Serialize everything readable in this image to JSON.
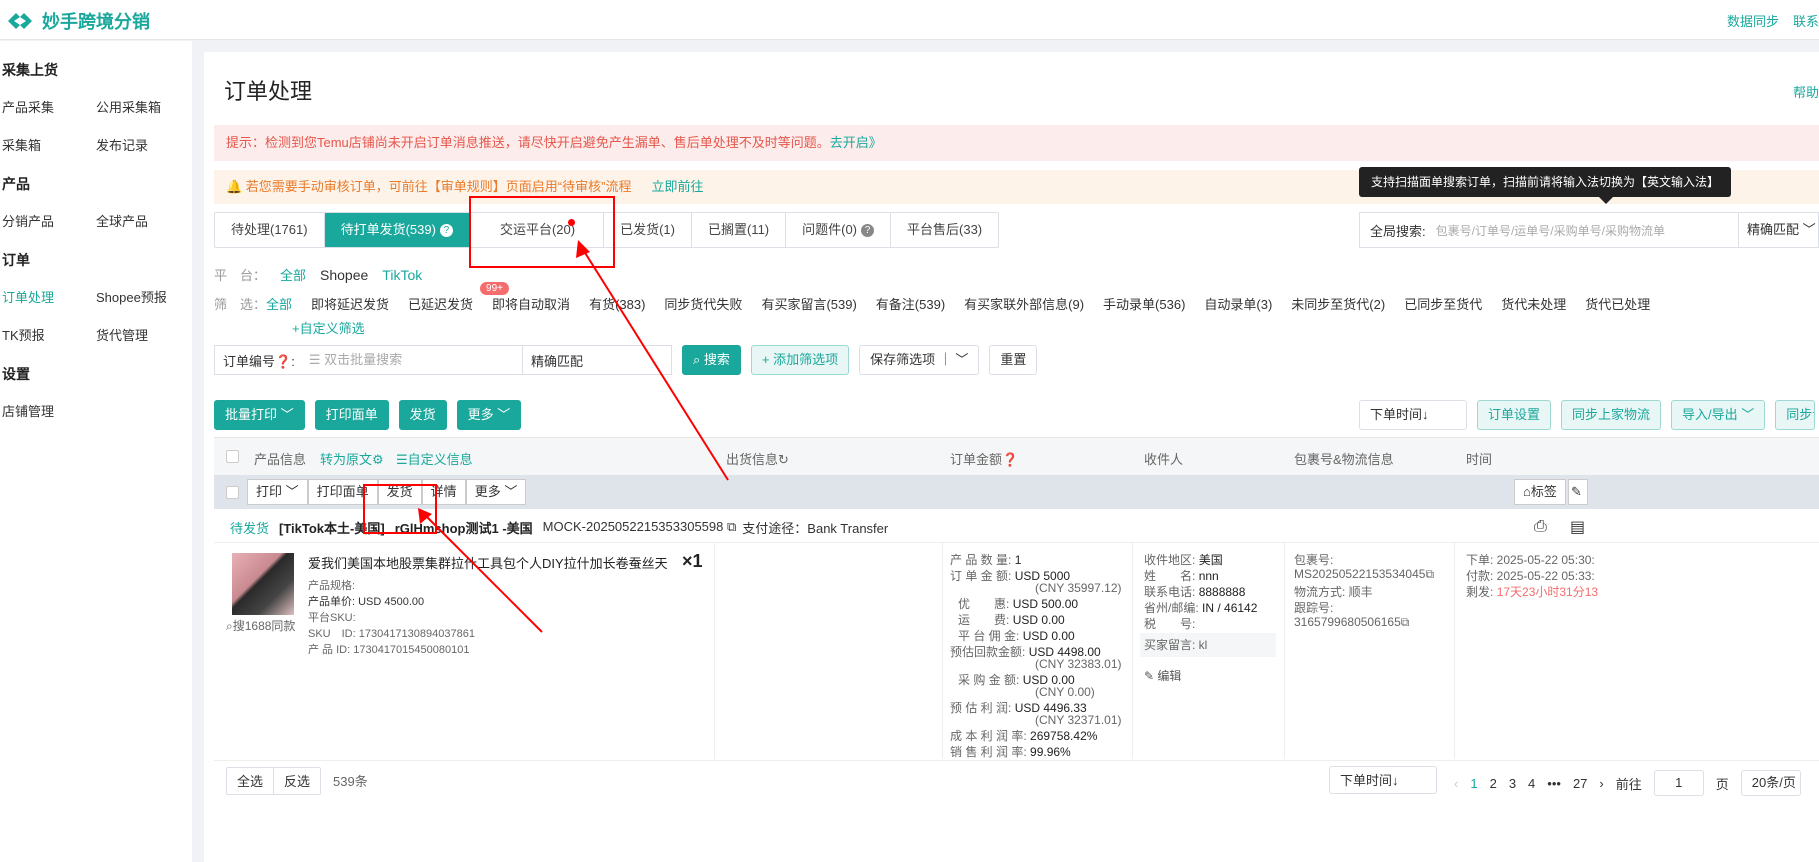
{
  "app": {
    "name": "妙手跨境分销",
    "top_links": [
      "数据同步",
      "联系"
    ]
  },
  "sidebar": [
    {
      "group": "采集上货",
      "rows": [
        [
          "产品采集",
          "公用采集箱"
        ],
        [
          "采集箱",
          "发布记录"
        ]
      ]
    },
    {
      "group": "产品",
      "rows": [
        [
          "分销产品",
          "全球产品"
        ]
      ]
    },
    {
      "group": "订单",
      "rows": [
        [
          "订单处理",
          "Shopee预报"
        ],
        [
          "TK预报",
          "货代管理"
        ]
      ]
    },
    {
      "group": "设置",
      "rows": [
        [
          "店铺管理"
        ]
      ]
    }
  ],
  "page": {
    "title": "订单处理",
    "help": "帮助"
  },
  "alerts": {
    "notice": "提示：检测到您Temu店铺尚未开启订单消息推送，请尽快开启避免产生漏单、售后单处理不及时等问题。",
    "notice_link": "去开启》",
    "review": "🔔 若您需要手动审核订单，可前往【审单规则】页面启用“待审核”流程",
    "review_link": "立即前往"
  },
  "tooltip": "支持扫描面单搜索订单，扫描前请将输入法切换为【英文输入法】",
  "tabs": [
    {
      "label": "待处理(1761)"
    },
    {
      "label": "待打单发货(539)",
      "active": true
    },
    {
      "label": "交运平台(20)"
    },
    {
      "label": "已发货(1)"
    },
    {
      "label": "已搁置(11)"
    },
    {
      "label": "问题件(0)"
    },
    {
      "label": "平台售后(33)"
    }
  ],
  "global_search": {
    "label": "全局搜索:",
    "placeholder": "包裹号/订单号/运单号/采购单号/采购物流单",
    "mode": "精确匹配"
  },
  "platform": {
    "label": "平　台：",
    "options": [
      "全部",
      "Shopee",
      "TikTok"
    ]
  },
  "filter": {
    "label": "筛　选：",
    "options": [
      "全部",
      "即将延迟发货",
      "已延迟发货",
      "即将自动取消",
      "有货(383)",
      "同步货代失败",
      "有买家留言(539)",
      "有备注(539)",
      "有买家联外部信息(9)",
      "手动录单(536)",
      "自动录单(3)",
      "未同步至货代(2)",
      "已同步至货代",
      "货代未处理",
      "货代已处理"
    ],
    "badge": "99+",
    "custom": "+自定义筛选"
  },
  "search_row": {
    "label": "订单编号",
    "placeholder": "双击批量搜索",
    "mode": "精确匹配",
    "search": "搜索",
    "add_filter": "+ 添加筛选项",
    "save_filter": "保存筛选项",
    "reset": "重置"
  },
  "actions": {
    "batch_print": "批量打印",
    "print_label": "打印面单",
    "ship": "发货",
    "more": "更多",
    "sort": "下单时间↓",
    "settings": "订单设置",
    "sync_logistics": "同步上家物流",
    "import_export": "导入/导出",
    "sync_order": "同步订单"
  },
  "table_head": {
    "product": "产品信息",
    "translate": "转为原文",
    "custom": "自定义信息",
    "shipping": "出货信息",
    "amount": "订单金额",
    "receiver": "收件人",
    "logistics": "包裹号&物流信息",
    "time": "时间"
  },
  "subbar": {
    "print": "打印",
    "print_label": "打印面单",
    "ship": "发货",
    "detail": "详情",
    "more": "更多",
    "tag": "标签",
    "note": "备注"
  },
  "order": {
    "status": "待发货",
    "shop": "[TikTok本土-美国]",
    "shop_name": "rGlHmshop测试1 -美国",
    "order_no": "MOCK-2025052215353305598",
    "payment": "支付途径：Bank Transfer",
    "product_title": "爱我们美国本地股票集群拉什工具包个人DIY拉什加长卷蚕丝天...",
    "spec": "产品规格:",
    "unit_price": "产品单价:  USD 4500.00",
    "platform_sku": "平台SKU:",
    "sku_id": "SKU　ID:  1730417130894037861",
    "product_id": "产 品 ID:  1730417015450080101",
    "same_1688": "搜1688同款",
    "qty": "×1",
    "amount": [
      [
        "产 品 数 量:",
        "1",
        ""
      ],
      [
        "订 单 金 额:",
        "USD 5000",
        "(CNY 35997.12)"
      ],
      [
        "优　　惠:",
        "USD 500.00",
        ""
      ],
      [
        "运　　费:",
        "USD 0.00",
        ""
      ],
      [
        "平 台 佣 金:",
        "USD 0.00",
        ""
      ],
      [
        "预估回款金额:",
        "USD 4498.00",
        "(CNY 32383.01)"
      ],
      [
        "采 购 金 额:",
        "USD 0.00",
        "(CNY 0.00)"
      ],
      [
        "预 估 利 润:",
        "USD 4496.33",
        "(CNY 32371.01)"
      ],
      [
        "成 本 利 润 率:",
        "269758.42%",
        ""
      ],
      [
        "销 售 利 润 率:",
        "99.96%",
        ""
      ]
    ],
    "receiver": [
      [
        "收件地区:",
        "美国"
      ],
      [
        "姓　　名:",
        "nnn"
      ],
      [
        "联系电话:",
        "8888888"
      ],
      [
        "省州/邮编:",
        "IN / 46142"
      ],
      [
        "税　　号:",
        ""
      ]
    ],
    "buyer_msg": "买家留言: kl",
    "edit": "编辑",
    "package_label": "包裹号:",
    "package_no": "MS20250522153534045",
    "logistics": "物流方式:  顺丰",
    "tracking_label": "跟踪号:",
    "tracking_no": "3165799680506165",
    "time_order": "下单:  2025-05-22 05:30:",
    "time_pay": "付款:  2025-05-22 05:33:",
    "time_left_label": "剩发:",
    "time_left": "17天23小时31分13"
  },
  "footer": {
    "select_all": "全选",
    "invert": "反选",
    "count": "539条",
    "sort": "下单时间↓",
    "pages": [
      "1",
      "2",
      "3",
      "4",
      "•••",
      "27"
    ],
    "goto": "前往",
    "page_value": "1",
    "page_unit": "页",
    "page_size": "20条/页"
  }
}
